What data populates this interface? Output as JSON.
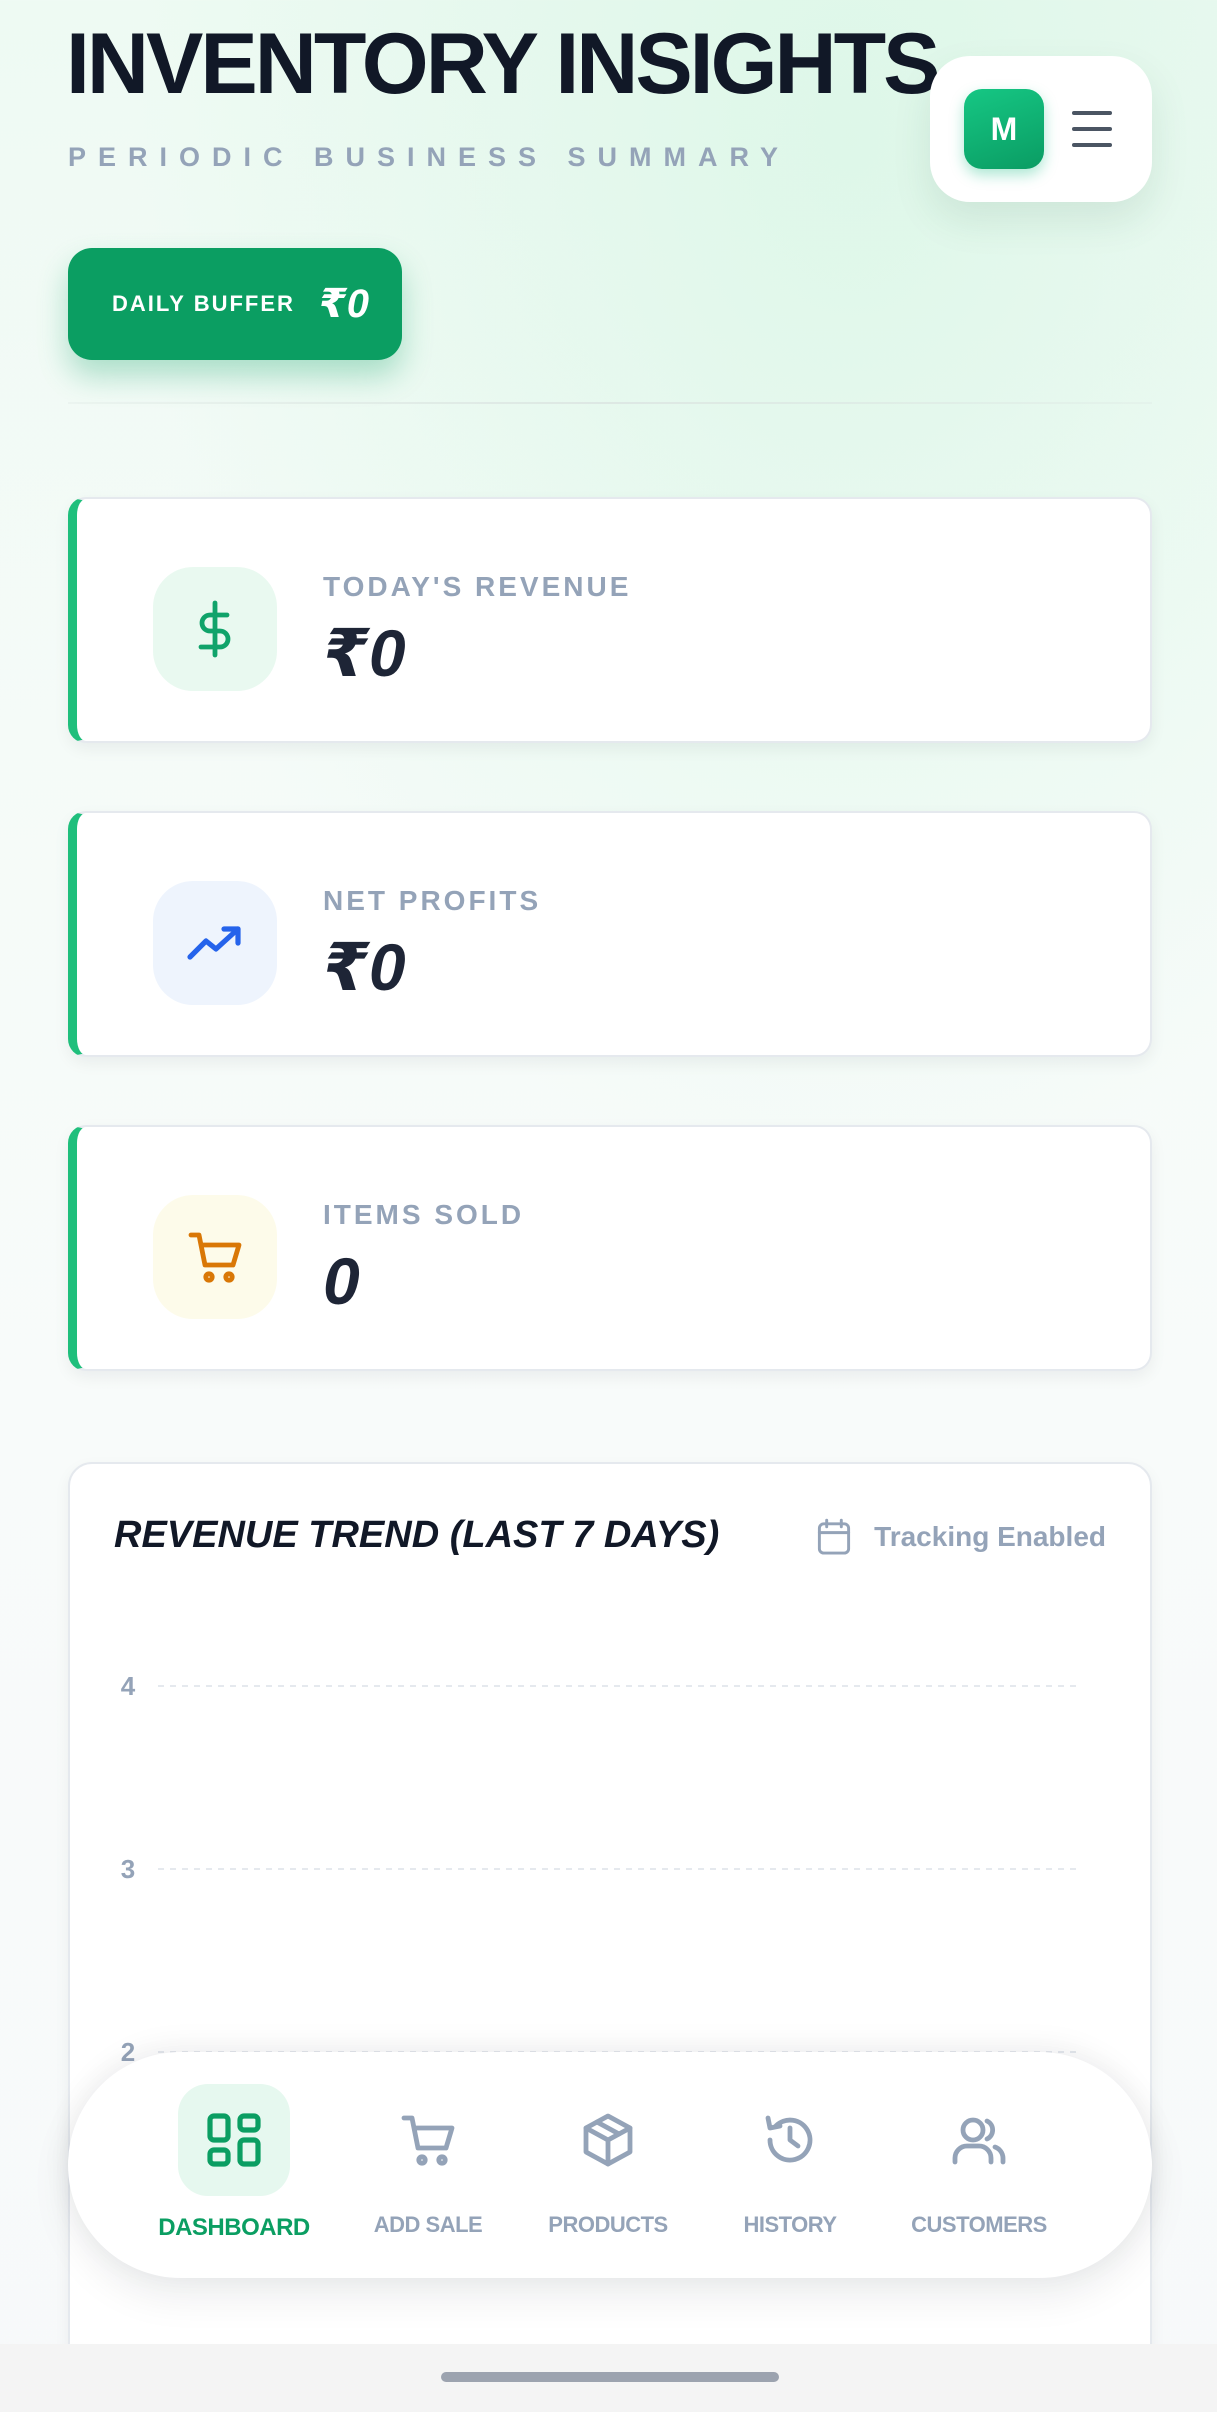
{
  "header": {
    "title": "INVENTORY INSIGHTS",
    "subtitle": "PERIODIC BUSINESS SUMMARY",
    "avatar_initial": "M"
  },
  "buffer": {
    "label": "DAILY BUFFER",
    "value": "₹0"
  },
  "stats": [
    {
      "label": "TODAY'S REVENUE",
      "value": "₹0",
      "icon": "dollar-icon",
      "icon_color": "#10a36a",
      "icon_bg": "#e9f9f0"
    },
    {
      "label": "NET PROFITS",
      "value": "₹0",
      "icon": "trending-up-icon",
      "icon_color": "#2563eb",
      "icon_bg": "#eef4fd"
    },
    {
      "label": "ITEMS SOLD",
      "value": "0",
      "icon": "cart-icon",
      "icon_color": "#d97706",
      "icon_bg": "#fdfbea"
    }
  ],
  "chart": {
    "tracking_label": "Tracking Enabled",
    "tracking_icon": "calendar-icon"
  },
  "chart_data": {
    "type": "line",
    "title": "REVENUE TREND (LAST 7 DAYS)",
    "xlabel": "",
    "ylabel": "",
    "y_ticks": [
      4,
      3,
      2
    ],
    "grid": true,
    "series": []
  },
  "nav": {
    "items": [
      {
        "label": "DASHBOARD",
        "icon": "grid-icon",
        "active": true
      },
      {
        "label": "ADD SALE",
        "icon": "cart-icon",
        "active": false
      },
      {
        "label": "PRODUCTS",
        "icon": "box-icon",
        "active": false
      },
      {
        "label": "HISTORY",
        "icon": "history-icon",
        "active": false
      },
      {
        "label": "CUSTOMERS",
        "icon": "users-icon",
        "active": false
      }
    ]
  },
  "colors": {
    "accent": "#0b9e62",
    "accent_light": "#1fbf7c",
    "text_dark": "#111827",
    "text_muted": "#94a3b8"
  }
}
